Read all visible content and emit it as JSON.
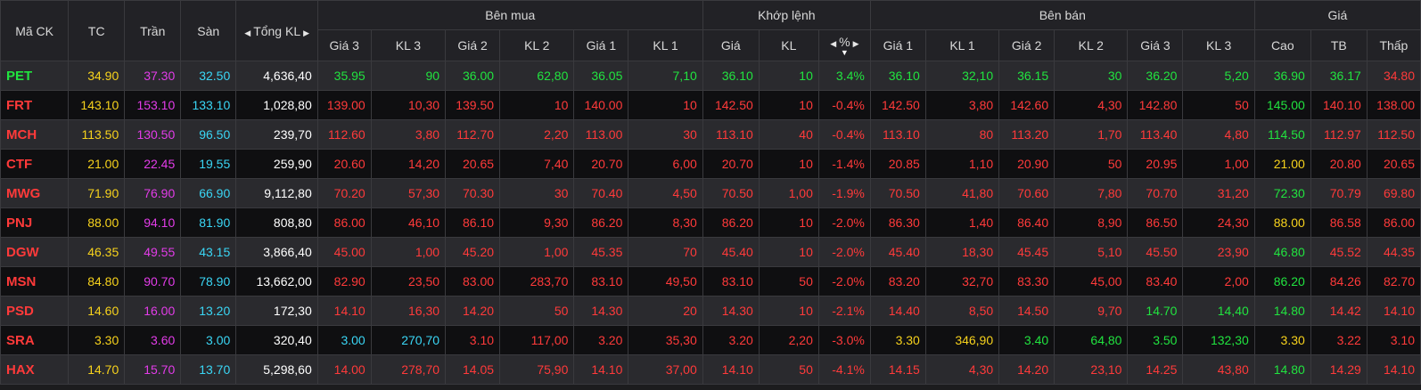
{
  "header": {
    "ma_ck": "Mã CK",
    "tc": "TC",
    "tran": "Trần",
    "san": "Sàn",
    "tong_kl": "Tổng KL",
    "groups": {
      "ben_mua": "Bên mua",
      "khop_lenh": "Khớp lệnh",
      "ben_ban": "Bên bán",
      "gia": "Giá"
    },
    "sub": {
      "gia3": "Giá 3",
      "kl3": "KL 3",
      "gia2": "Giá 2",
      "kl2": "KL 2",
      "gia1": "Giá 1",
      "kl1": "KL 1",
      "khop_gia": "Giá",
      "khop_kl": "KL",
      "pct": "%",
      "ban_gia1": "Giá 1",
      "ban_kl1": "KL 1",
      "ban_gia2": "Giá 2",
      "ban_kl2": "KL 2",
      "ban_gia3": "Giá 3",
      "ban_kl3": "KL 3",
      "cao": "Cao",
      "tb": "TB",
      "thap": "Thấp"
    }
  },
  "colors": {
    "up": "#21e33f",
    "down": "#ff3a3a",
    "ref": "#f7d21c",
    "ceil": "#e23ce8",
    "floor": "#3ad6f5",
    "neutral": "#ffffff"
  },
  "rows": [
    [
      "PET",
      "34.90",
      "37.30",
      "32.50",
      "4,636,40",
      "35.95",
      "90",
      "36.00",
      "62,80",
      "36.05",
      "7,10",
      "36.10",
      "10",
      "3.4%",
      "36.10",
      "32,10",
      "36.15",
      "30",
      "36.20",
      "5,20",
      "36.90",
      "36.17",
      "34.80"
    ],
    [
      "FRT",
      "143.10",
      "153.10",
      "133.10",
      "1,028,80",
      "139.00",
      "10,30",
      "139.50",
      "10",
      "140.00",
      "10",
      "142.50",
      "10",
      "-0.4%",
      "142.50",
      "3,80",
      "142.60",
      "4,30",
      "142.80",
      "50",
      "145.00",
      "140.10",
      "138.00"
    ],
    [
      "MCH",
      "113.50",
      "130.50",
      "96.50",
      "239,70",
      "112.60",
      "3,80",
      "112.70",
      "2,20",
      "113.00",
      "30",
      "113.10",
      "40",
      "-0.4%",
      "113.10",
      "80",
      "113.20",
      "1,70",
      "113.40",
      "4,80",
      "114.50",
      "112.97",
      "112.50"
    ],
    [
      "CTF",
      "21.00",
      "22.45",
      "19.55",
      "259,90",
      "20.60",
      "14,20",
      "20.65",
      "7,40",
      "20.70",
      "6,00",
      "20.70",
      "10",
      "-1.4%",
      "20.85",
      "1,10",
      "20.90",
      "50",
      "20.95",
      "1,00",
      "21.00",
      "20.80",
      "20.65"
    ],
    [
      "MWG",
      "71.90",
      "76.90",
      "66.90",
      "9,112,80",
      "70.20",
      "57,30",
      "70.30",
      "30",
      "70.40",
      "4,50",
      "70.50",
      "1,00",
      "-1.9%",
      "70.50",
      "41,80",
      "70.60",
      "7,80",
      "70.70",
      "31,20",
      "72.30",
      "70.79",
      "69.80"
    ],
    [
      "PNJ",
      "88.00",
      "94.10",
      "81.90",
      "808,80",
      "86.00",
      "46,10",
      "86.10",
      "9,30",
      "86.20",
      "8,30",
      "86.20",
      "10",
      "-2.0%",
      "86.30",
      "1,40",
      "86.40",
      "8,90",
      "86.50",
      "24,30",
      "88.00",
      "86.58",
      "86.00"
    ],
    [
      "DGW",
      "46.35",
      "49.55",
      "43.15",
      "3,866,40",
      "45.00",
      "1,00",
      "45.20",
      "1,00",
      "45.35",
      "70",
      "45.40",
      "10",
      "-2.0%",
      "45.40",
      "18,30",
      "45.45",
      "5,10",
      "45.50",
      "23,90",
      "46.80",
      "45.52",
      "44.35"
    ],
    [
      "MSN",
      "84.80",
      "90.70",
      "78.90",
      "13,662,00",
      "82.90",
      "23,50",
      "83.00",
      "283,70",
      "83.10",
      "49,50",
      "83.10",
      "50",
      "-2.0%",
      "83.20",
      "32,70",
      "83.30",
      "45,00",
      "83.40",
      "2,00",
      "86.20",
      "84.26",
      "82.70"
    ],
    [
      "PSD",
      "14.60",
      "16.00",
      "13.20",
      "172,30",
      "14.10",
      "16,30",
      "14.20",
      "50",
      "14.30",
      "20",
      "14.30",
      "10",
      "-2.1%",
      "14.40",
      "8,50",
      "14.50",
      "9,70",
      "14.70",
      "14,40",
      "14.80",
      "14.42",
      "14.10"
    ],
    [
      "SRA",
      "3.30",
      "3.60",
      "3.00",
      "320,40",
      "3.00",
      "270,70",
      "3.10",
      "117,00",
      "3.20",
      "35,30",
      "3.20",
      "2,20",
      "-3.0%",
      "3.30",
      "346,90",
      "3.40",
      "64,80",
      "3.50",
      "132,30",
      "3.30",
      "3.22",
      "3.10"
    ],
    [
      "HAX",
      "14.70",
      "15.70",
      "13.70",
      "5,298,60",
      "14.00",
      "278,70",
      "14.05",
      "75,90",
      "14.10",
      "37,00",
      "14.10",
      "50",
      "-4.1%",
      "14.15",
      "4,30",
      "14.20",
      "23,10",
      "14.25",
      "43,80",
      "14.80",
      "14.29",
      "14.10"
    ]
  ],
  "row_colors": [
    [
      "up",
      "ref",
      "ceil",
      "floor",
      "neutral",
      "up",
      "up",
      "up",
      "up",
      "up",
      "up",
      "up",
      "up",
      "up",
      "up",
      "up",
      "up",
      "up",
      "up",
      "up",
      "up",
      "up",
      "down"
    ],
    [
      "down",
      "ref",
      "ceil",
      "floor",
      "neutral",
      "down",
      "down",
      "down",
      "down",
      "down",
      "down",
      "down",
      "down",
      "down",
      "down",
      "down",
      "down",
      "down",
      "down",
      "down",
      "up",
      "down",
      "down"
    ],
    [
      "down",
      "ref",
      "ceil",
      "floor",
      "neutral",
      "down",
      "down",
      "down",
      "down",
      "down",
      "down",
      "down",
      "down",
      "down",
      "down",
      "down",
      "down",
      "down",
      "down",
      "down",
      "up",
      "down",
      "down"
    ],
    [
      "down",
      "ref",
      "ceil",
      "floor",
      "neutral",
      "down",
      "down",
      "down",
      "down",
      "down",
      "down",
      "down",
      "down",
      "down",
      "down",
      "down",
      "down",
      "down",
      "down",
      "down",
      "ref",
      "down",
      "down"
    ],
    [
      "down",
      "ref",
      "ceil",
      "floor",
      "neutral",
      "down",
      "down",
      "down",
      "down",
      "down",
      "down",
      "down",
      "down",
      "down",
      "down",
      "down",
      "down",
      "down",
      "down",
      "down",
      "up",
      "down",
      "down"
    ],
    [
      "down",
      "ref",
      "ceil",
      "floor",
      "neutral",
      "down",
      "down",
      "down",
      "down",
      "down",
      "down",
      "down",
      "down",
      "down",
      "down",
      "down",
      "down",
      "down",
      "down",
      "down",
      "ref",
      "down",
      "down"
    ],
    [
      "down",
      "ref",
      "ceil",
      "floor",
      "neutral",
      "down",
      "down",
      "down",
      "down",
      "down",
      "down",
      "down",
      "down",
      "down",
      "down",
      "down",
      "down",
      "down",
      "down",
      "down",
      "up",
      "down",
      "down"
    ],
    [
      "down",
      "ref",
      "ceil",
      "floor",
      "neutral",
      "down",
      "down",
      "down",
      "down",
      "down",
      "down",
      "down",
      "down",
      "down",
      "down",
      "down",
      "down",
      "down",
      "down",
      "down",
      "up",
      "down",
      "down"
    ],
    [
      "down",
      "ref",
      "ceil",
      "floor",
      "neutral",
      "down",
      "down",
      "down",
      "down",
      "down",
      "down",
      "down",
      "down",
      "down",
      "down",
      "down",
      "down",
      "down",
      "up",
      "up",
      "up",
      "down",
      "down"
    ],
    [
      "down",
      "ref",
      "ceil",
      "floor",
      "neutral",
      "floor",
      "floor",
      "down",
      "down",
      "down",
      "down",
      "down",
      "down",
      "down",
      "ref",
      "ref",
      "up",
      "up",
      "up",
      "up",
      "ref",
      "down",
      "down"
    ],
    [
      "down",
      "ref",
      "ceil",
      "floor",
      "neutral",
      "down",
      "down",
      "down",
      "down",
      "down",
      "down",
      "down",
      "down",
      "down",
      "down",
      "down",
      "down",
      "down",
      "down",
      "down",
      "up",
      "down",
      "down"
    ]
  ]
}
